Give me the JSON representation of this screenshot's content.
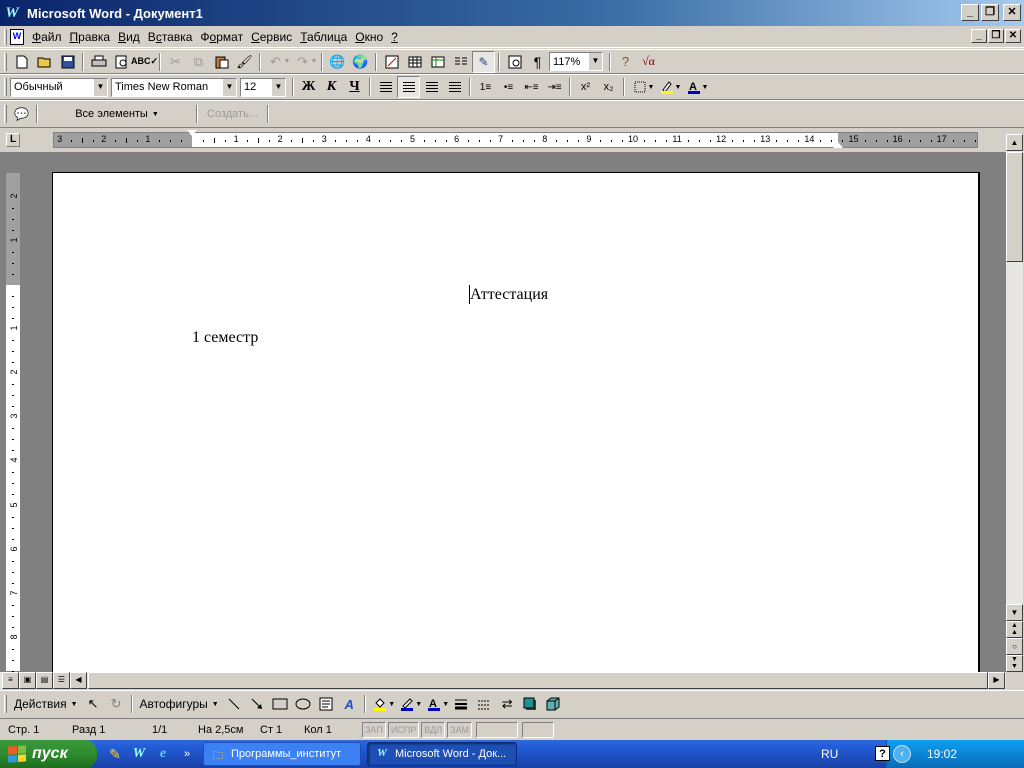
{
  "window": {
    "title": "Microsoft Word - Документ1"
  },
  "menu": {
    "items": [
      {
        "label": "Файл",
        "u": "Ф"
      },
      {
        "label": "Правка",
        "u": "П"
      },
      {
        "label": "Вид",
        "u": "В"
      },
      {
        "label": "Вставка",
        "u": "с"
      },
      {
        "label": "Формат",
        "u": "о"
      },
      {
        "label": "Сервис",
        "u": "С"
      },
      {
        "label": "Таблица",
        "u": "Т"
      },
      {
        "label": "Окно",
        "u": "О"
      },
      {
        "label": "?",
        "u": "?"
      }
    ]
  },
  "standard_toolbar": {
    "zoom": "117%"
  },
  "formatting_toolbar": {
    "style": "Обычный",
    "font": "Times New Roman",
    "size": "12",
    "bold": "Ж",
    "italic": "К",
    "underline": "Ч"
  },
  "extra_toolbar": {
    "all_elements": "Все элементы",
    "create": "Создать..."
  },
  "ruler": {
    "h_numbers": [
      "3",
      "2",
      "1",
      "1",
      "2",
      "3",
      "4",
      "5",
      "6",
      "7",
      "8",
      "9",
      "10",
      "11",
      "12",
      "13",
      "14",
      "15",
      "16",
      "17"
    ],
    "v_numbers": [
      "2",
      "1",
      "1",
      "2",
      "3",
      "4",
      "5",
      "6",
      "7",
      "8"
    ]
  },
  "document": {
    "heading": "Аттестация",
    "line2": "1 семестр"
  },
  "drawing_toolbar": {
    "actions": "Действия",
    "autoshapes": "Автофигуры"
  },
  "status": {
    "page": "Стр. 1",
    "section": "Разд 1",
    "pages": "1/1",
    "at": "На 2,5см",
    "line": "Ст 1",
    "col": "Кол 1",
    "rec": "ЗАП",
    "trk": "ИСПР",
    "ext": "ВДЛ",
    "ovr": "ЗАМ"
  },
  "taskbar": {
    "start": "пуск",
    "tasks": [
      {
        "label": "Программы_институт",
        "active": false
      },
      {
        "label": "Microsoft Word - Док...",
        "active": true
      }
    ],
    "lang": "RU",
    "clock": "19:02"
  },
  "colors": {
    "title_bar": "#0a246a",
    "taskbar": "#245edb",
    "start": "#2e8b2e"
  }
}
